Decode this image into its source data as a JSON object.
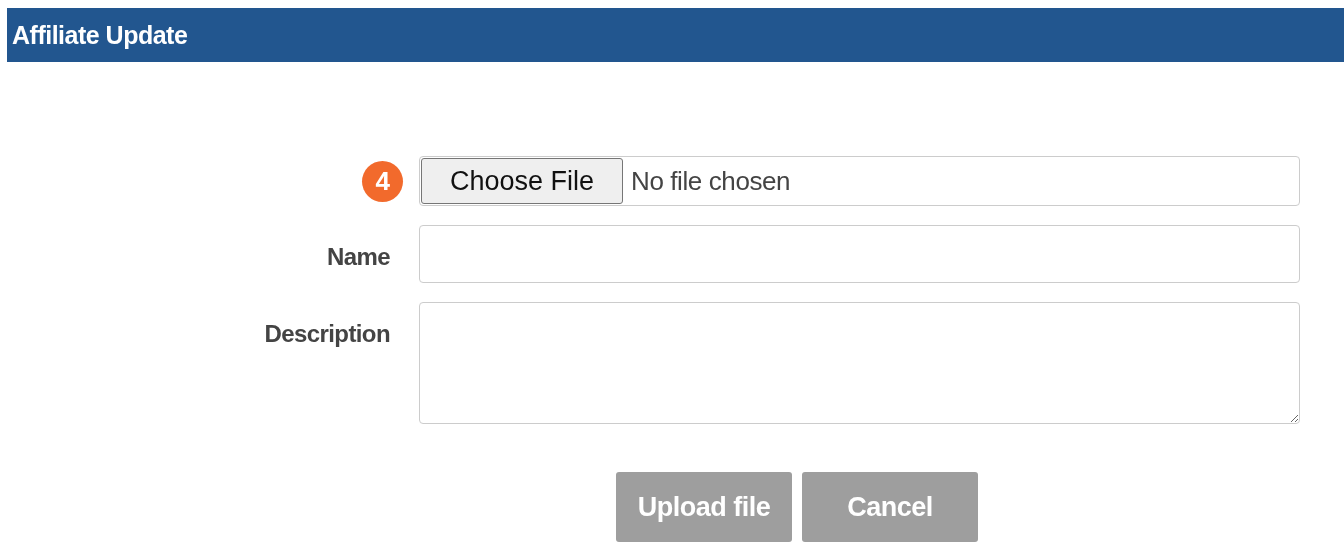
{
  "header": {
    "title": "Affiliate Update"
  },
  "form": {
    "file": {
      "step_badge": "4",
      "button": "Choose File",
      "status": "No file chosen"
    },
    "fields": [
      {
        "label": "Name",
        "kind": "input"
      },
      {
        "label": "Description",
        "kind": "textarea"
      }
    ]
  },
  "buttons": [
    {
      "label": "Upload file"
    },
    {
      "label": "Cancel"
    }
  ]
}
